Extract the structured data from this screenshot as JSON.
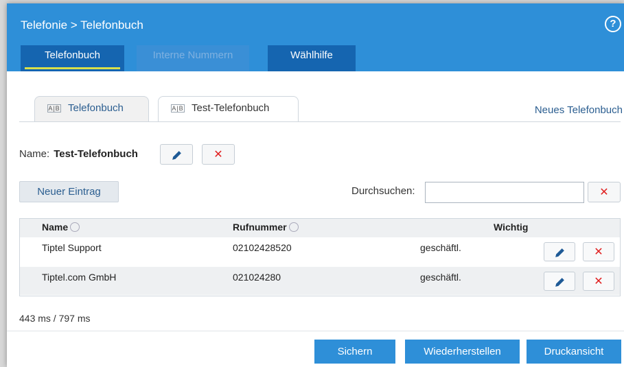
{
  "header": {
    "breadcrumb": "Telefonie > Telefonbuch",
    "help_icon": "?",
    "tabs": [
      {
        "label": "Telefonbuch",
        "state": "active"
      },
      {
        "label": "Interne Nummern",
        "state": "disabled"
      },
      {
        "label": "Wählhilfe",
        "state": "normal"
      }
    ]
  },
  "books": {
    "tabs": [
      {
        "icon": "A|B",
        "label": "Telefonbuch"
      },
      {
        "icon": "A|B",
        "label": "Test-Telefonbuch"
      }
    ],
    "new_book_link": "Neues Telefonbuch"
  },
  "name_row": {
    "label": "Name:",
    "value": "Test-Telefonbuch"
  },
  "toolbar": {
    "new_entry": "Neuer Eintrag",
    "search_label": "Durchsuchen:",
    "search_value": ""
  },
  "table": {
    "columns": [
      "Name",
      "Rufnummer",
      "Wichtig"
    ],
    "rows": [
      {
        "name": "Tiptel Support",
        "number": "02102428520",
        "type": "geschäftl."
      },
      {
        "name": "Tiptel.com GmbH",
        "number": "021024280",
        "type": "geschäftl."
      }
    ]
  },
  "timing": "443 ms / 797 ms",
  "footer": {
    "save": "Sichern",
    "restore": "Wiederherstellen",
    "print": "Druckansicht"
  },
  "colors": {
    "header_blue": "#2e8fd8",
    "active_tab_underline": "#d9e04a",
    "delete_red": "#e02020",
    "link_blue": "#2b5e90"
  }
}
